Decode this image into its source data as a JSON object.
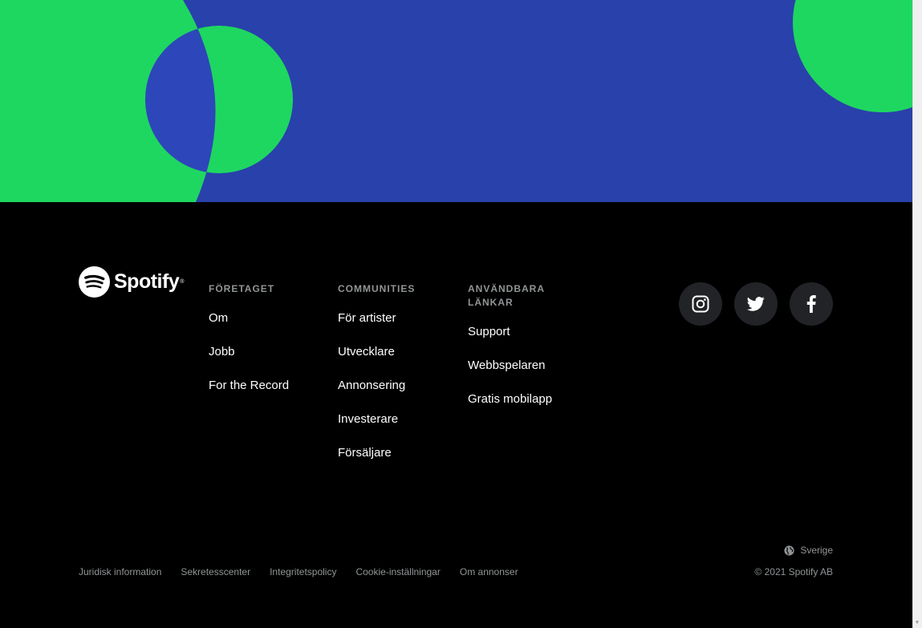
{
  "hero": {
    "colors": {
      "background": "#2941ab",
      "accent": "#1ed760",
      "overlap": "#2d46b9"
    }
  },
  "footer": {
    "logo": {
      "wordmark": "Spotify",
      "icon": "spotify-logo-icon"
    },
    "columns": [
      {
        "heading": "FÖRETAGET",
        "links": [
          "Om",
          "Jobb",
          "For the Record"
        ]
      },
      {
        "heading": "COMMUNITIES",
        "links": [
          "För artister",
          "Utvecklare",
          "Annonsering",
          "Investerare",
          "Försäljare"
        ]
      },
      {
        "heading": "ANVÄNDBARA LÄNKAR",
        "links": [
          "Support",
          "Webbspelaren",
          "Gratis mobilapp"
        ]
      }
    ],
    "socials": [
      {
        "icon": "instagram-icon"
      },
      {
        "icon": "twitter-icon"
      },
      {
        "icon": "facebook-icon"
      }
    ],
    "region": {
      "icon": "globe-icon",
      "label": "Sverige"
    },
    "legal_links": [
      "Juridisk information",
      "Sekretesscenter",
      "Integritetspolicy",
      "Cookie-inställningar",
      "Om annonser"
    ],
    "copyright": "© 2021 Spotify AB"
  }
}
